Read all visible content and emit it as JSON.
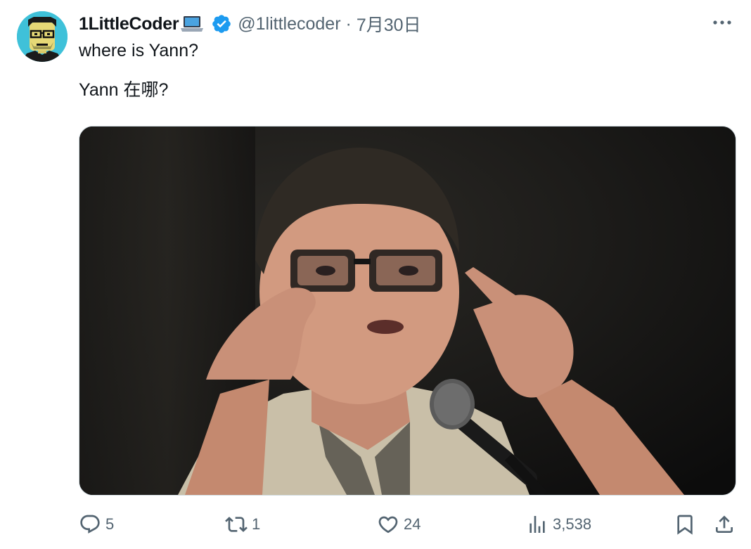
{
  "tweet": {
    "display_name": "1LittleCoder",
    "name_emoji_icon": "laptop-icon",
    "verified_icon": "verified-badge-icon",
    "handle": "@1littlecoder",
    "separator": "·",
    "date": "7月30日",
    "text_lines": [
      "where is Yann?",
      "Yann 在哪?"
    ],
    "media_description_icon": "photo",
    "colors": {
      "text": "#0f1419",
      "muted": "#536471",
      "verified": "#1d9bf0",
      "avatar_bg": "#3fc1d9"
    }
  },
  "actions": {
    "reply": {
      "icon": "reply-icon",
      "count": "5"
    },
    "retweet": {
      "icon": "retweet-icon",
      "count": "1"
    },
    "like": {
      "icon": "heart-icon",
      "count": "24"
    },
    "views": {
      "icon": "views-icon",
      "count": "3,538"
    },
    "bookmark": {
      "icon": "bookmark-icon"
    },
    "share": {
      "icon": "share-icon"
    }
  }
}
